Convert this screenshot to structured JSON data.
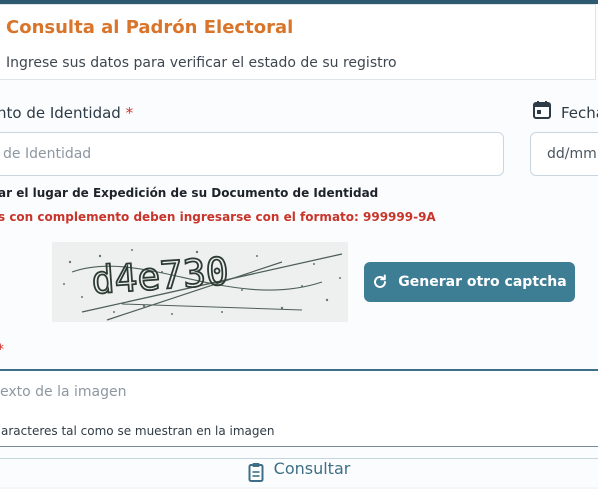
{
  "header": {
    "title": "Consulta al Padrón Electoral",
    "subtitle": "Ingrese sus datos para verificar el estado de su registro"
  },
  "form": {
    "id_label": "nto de Identidad",
    "required_mark": "*",
    "date_label": "Fecha",
    "id_placeholder": "de Identidad",
    "date_placeholder": "dd/mm",
    "note_expedition": "ar el lugar de Expedición de su Documento de Identidad",
    "note_complement": "s con complemento deben ingresarse con el formato: 999999-9A",
    "captcha_text": "d4e730",
    "captcha_button": "Generar otro captcha",
    "captcha_required_mark": "*",
    "captcha_placeholder": "exto de la imagen",
    "captcha_help": "aracteres tal como se muestran en la imagen",
    "submit_label": "Consultar"
  },
  "colors": {
    "accent_orange": "#d9752b",
    "primary_blue": "#3e7e95",
    "error_red": "#c8352b"
  },
  "icons": [
    "calendar-icon",
    "refresh-icon",
    "clipboard-icon"
  ]
}
